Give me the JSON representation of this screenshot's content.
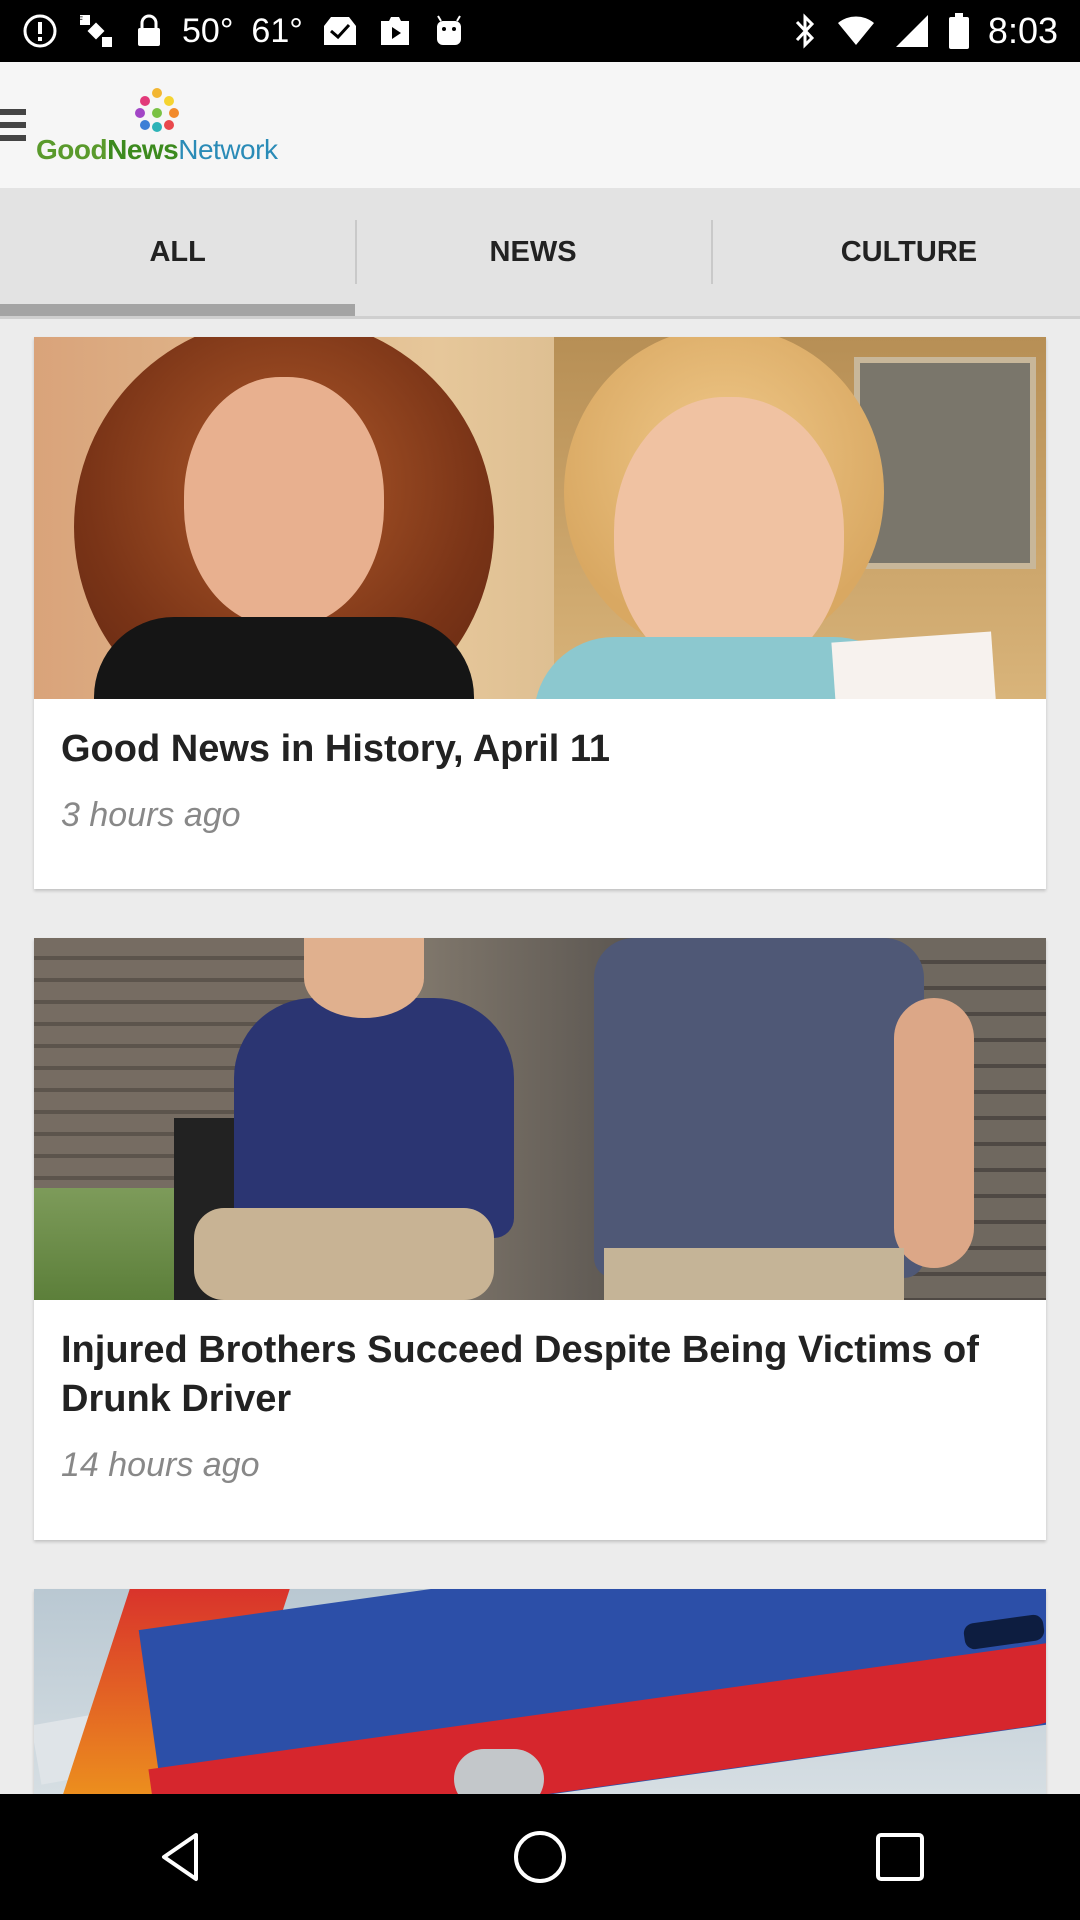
{
  "status_bar": {
    "left_icons": [
      "alert-icon",
      "fake-gps-icon",
      "lock-icon"
    ],
    "temp1": "50°",
    "temp2": "61°",
    "more_icons": [
      "inbox-icon",
      "play-store-icon",
      "android-icon"
    ],
    "right_icons": [
      "bluetooth-icon",
      "wifi-icon",
      "cellular-icon",
      "battery-icon"
    ],
    "time": "8:03"
  },
  "app_bar": {
    "menu_icon": "hamburger-menu-icon",
    "logo": {
      "good": "Good",
      "news": "News",
      "network": "Network"
    }
  },
  "tabs": [
    {
      "label": "ALL",
      "active": true
    },
    {
      "label": "NEWS",
      "active": false
    },
    {
      "label": "CULTURE",
      "active": false
    }
  ],
  "articles": [
    {
      "title": "Good News in History, April 11",
      "time": "3 hours ago"
    },
    {
      "title": "Injured Brothers Succeed Despite Being Victims of Drunk Driver",
      "time": "14 hours ago"
    },
    {
      "title": "",
      "time": ""
    }
  ],
  "nav_bar": {
    "back": "back-icon",
    "home": "home-icon",
    "recents": "recents-icon"
  },
  "colors": {
    "status_bar": "#000000",
    "app_bar": "#f6f6f6",
    "tabs_bg": "#e3e3e3",
    "tab_indicator": "#a4a4a4",
    "logo_green": "#5a9a2c",
    "logo_blue": "#2a8bb7"
  }
}
